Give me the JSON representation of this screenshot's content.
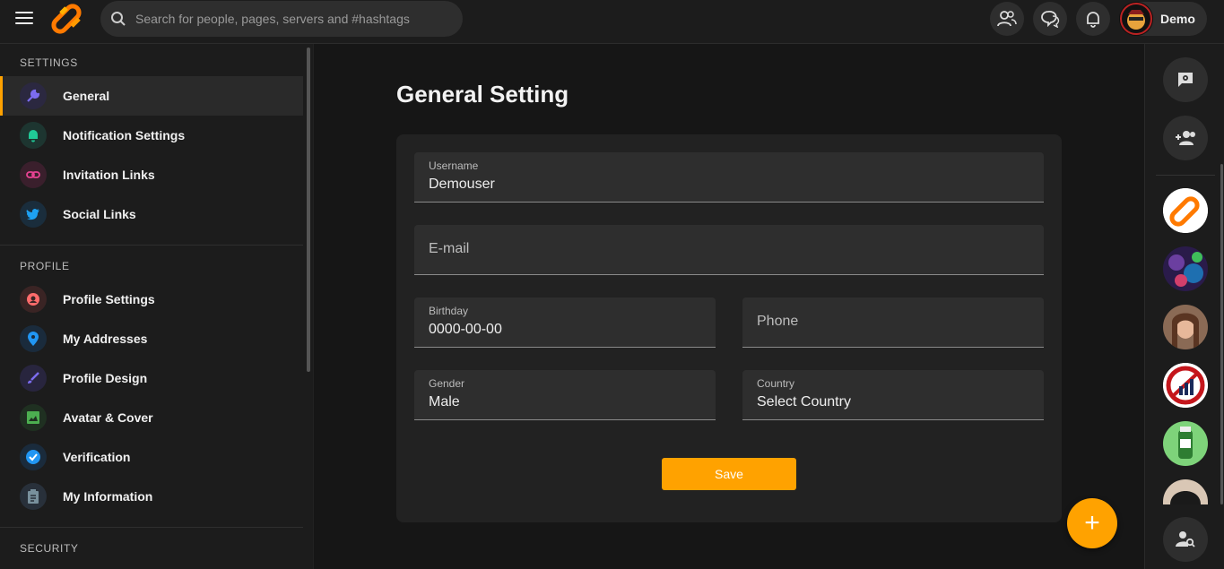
{
  "header": {
    "search_placeholder": "Search for people, pages, servers and #hashtags",
    "user_name": "Demo"
  },
  "sidebar": {
    "sections": [
      {
        "title": "SETTINGS"
      },
      {
        "title": "PROFILE"
      },
      {
        "title": "SECURITY"
      }
    ],
    "items": [
      {
        "label": "General",
        "icon": "wrench-icon",
        "color": "#6c5ce7"
      },
      {
        "label": "Notification Settings",
        "icon": "bell-icon",
        "color": "#20c997"
      },
      {
        "label": "Invitation Links",
        "icon": "link-icon",
        "color": "#e84393"
      },
      {
        "label": "Social Links",
        "icon": "twitter-icon",
        "color": "#1da1f2"
      },
      {
        "label": "Profile Settings",
        "icon": "profile-icon",
        "color": "#ff6b6b"
      },
      {
        "label": "My Addresses",
        "icon": "location-pin-icon",
        "color": "#2196f3"
      },
      {
        "label": "Profile Design",
        "icon": "brush-icon",
        "color": "#7c6cf0"
      },
      {
        "label": "Avatar & Cover",
        "icon": "image-icon",
        "color": "#4caf50"
      },
      {
        "label": "Verification",
        "icon": "verified-badge-icon",
        "color": "#2196f3"
      },
      {
        "label": "My Information",
        "icon": "clipboard-icon",
        "color": "#78909c"
      }
    ]
  },
  "main": {
    "title": "General Setting",
    "fields": {
      "username": {
        "label": "Username",
        "value": "Demouser"
      },
      "email": {
        "placeholder": "E-mail"
      },
      "birthday": {
        "label": "Birthday",
        "value": "0000-00-00"
      },
      "phone": {
        "placeholder": "Phone"
      },
      "gender": {
        "label": "Gender",
        "value": "Male"
      },
      "country": {
        "label": "Country",
        "value": "Select Country"
      }
    },
    "save_label": "Save"
  },
  "fab_label": "+",
  "colors": {
    "accent": "#ffa200",
    "background": "#161616",
    "panel": "#1c1c1c",
    "card": "#222222",
    "field": "#2e2e2e"
  }
}
